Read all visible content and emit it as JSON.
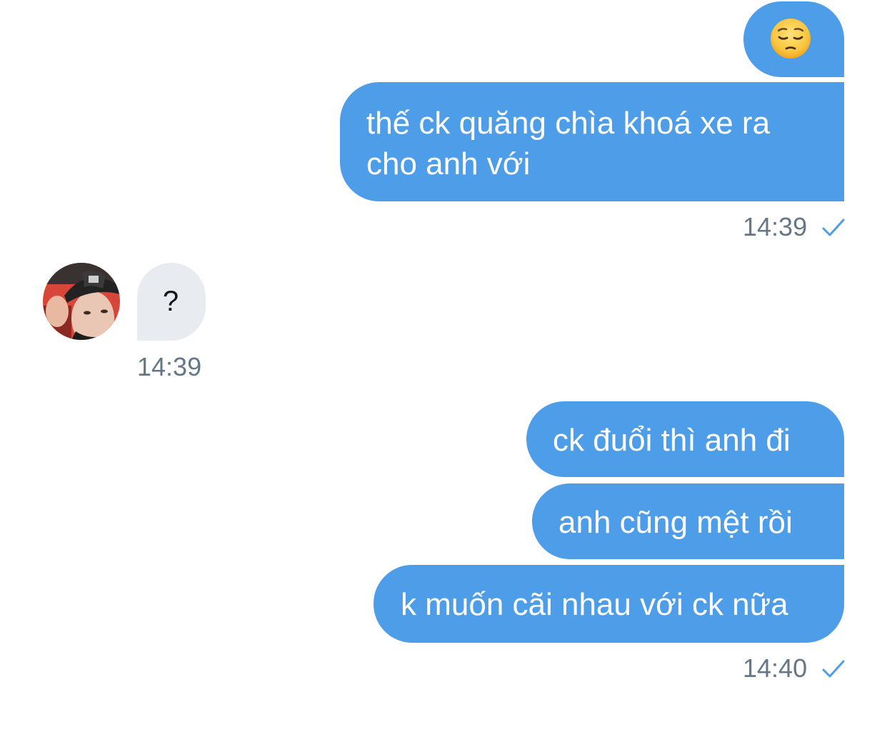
{
  "conversation": {
    "outgoing_group_1": {
      "emoji_name": "pensive-face-emoji",
      "line1": "thế ck quăng chìa khoá xe ra",
      "line2": "cho anh với",
      "time": "14:39",
      "status_icon": "check-icon"
    },
    "incoming_group_1": {
      "avatar_icon": "avatar",
      "text": "?",
      "time": "14:39"
    },
    "outgoing_group_2": {
      "msg1": "ck đuổi thì anh đi",
      "msg2": "anh cũng mệt rồi",
      "msg3": "k muốn cãi nhau với ck nữa",
      "time": "14:40",
      "status_icon": "check-icon"
    }
  },
  "colors": {
    "outgoing_bubble": "#4d9de8",
    "incoming_bubble": "#e8ebef",
    "timestamp": "#657786",
    "check": "#4d9de8"
  }
}
